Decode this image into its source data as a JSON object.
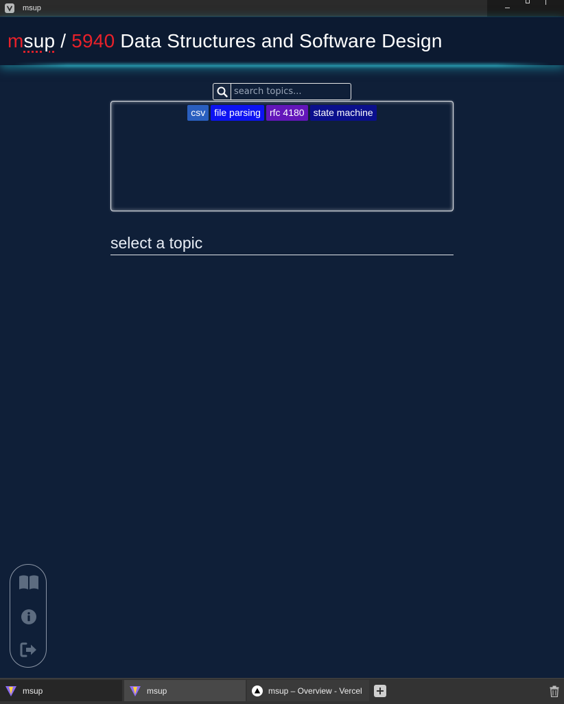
{
  "window": {
    "title": "msup"
  },
  "header": {
    "brand_m": "m",
    "brand_sup": "sup",
    "separator": "/",
    "course_number": "5940",
    "course_name": "Data Structures and Software Design"
  },
  "search": {
    "placeholder": "search topics...",
    "value": ""
  },
  "tags": [
    {
      "label": "csv",
      "color": "#2a5fbf"
    },
    {
      "label": "file parsing",
      "color": "#0d13f2"
    },
    {
      "label": "rfc 4180",
      "color": "#6316ba"
    },
    {
      "label": "state machine",
      "color": "#0a0f8c"
    }
  ],
  "main": {
    "heading": "select a topic"
  },
  "side_nav": {
    "icons": [
      "book-icon",
      "info-icon",
      "logout-icon"
    ],
    "icon_color": "#5d6c80"
  },
  "tabbar": {
    "tabs": [
      {
        "label": "msup",
        "icon": "vite-logo-icon"
      },
      {
        "label": "msup",
        "icon": "vite-logo-icon"
      },
      {
        "label": "msup – Overview - Vercel",
        "icon": "vercel-logo-icon"
      }
    ],
    "new_tab_icon": "plus-icon",
    "trash_icon": "trash-icon"
  },
  "colors": {
    "background": "#0f1f38",
    "header_bg": "#0c1a31",
    "accent_red": "#e8212a",
    "glow": "#34c8dc"
  }
}
